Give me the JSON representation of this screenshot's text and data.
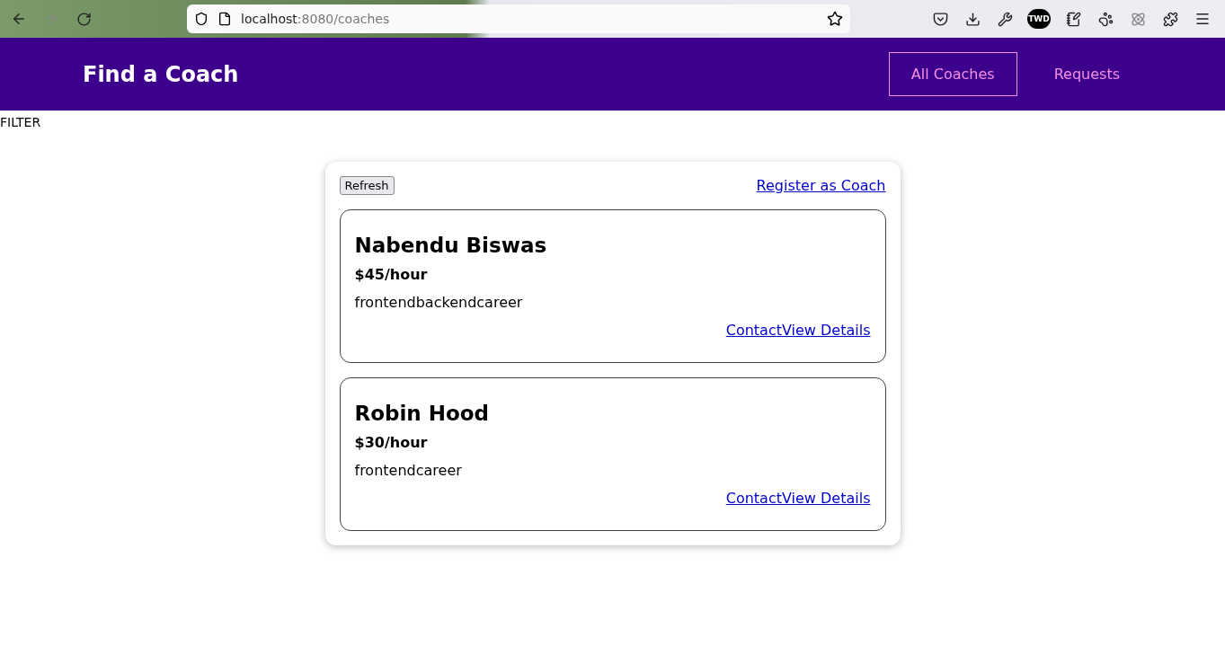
{
  "browser": {
    "url_host": "localhost",
    "url_path": ":8080/coaches",
    "extension_badge": "TWD"
  },
  "header": {
    "title": "Find a Coach",
    "nav": [
      {
        "label": "All Coaches",
        "selected": true
      },
      {
        "label": "Requests",
        "selected": false
      }
    ]
  },
  "filter": {
    "label": "FILTER"
  },
  "controls": {
    "refresh": "Refresh",
    "register": "Register as Coach"
  },
  "coaches": [
    {
      "name": "Nabendu Biswas",
      "rate": "$45/hour",
      "areas": "frontendbackendcareer",
      "contact": "Contact",
      "details": "View Details"
    },
    {
      "name": "Robin Hood",
      "rate": "$30/hour",
      "areas": "frontendcareer",
      "contact": "Contact",
      "details": "View Details"
    }
  ]
}
